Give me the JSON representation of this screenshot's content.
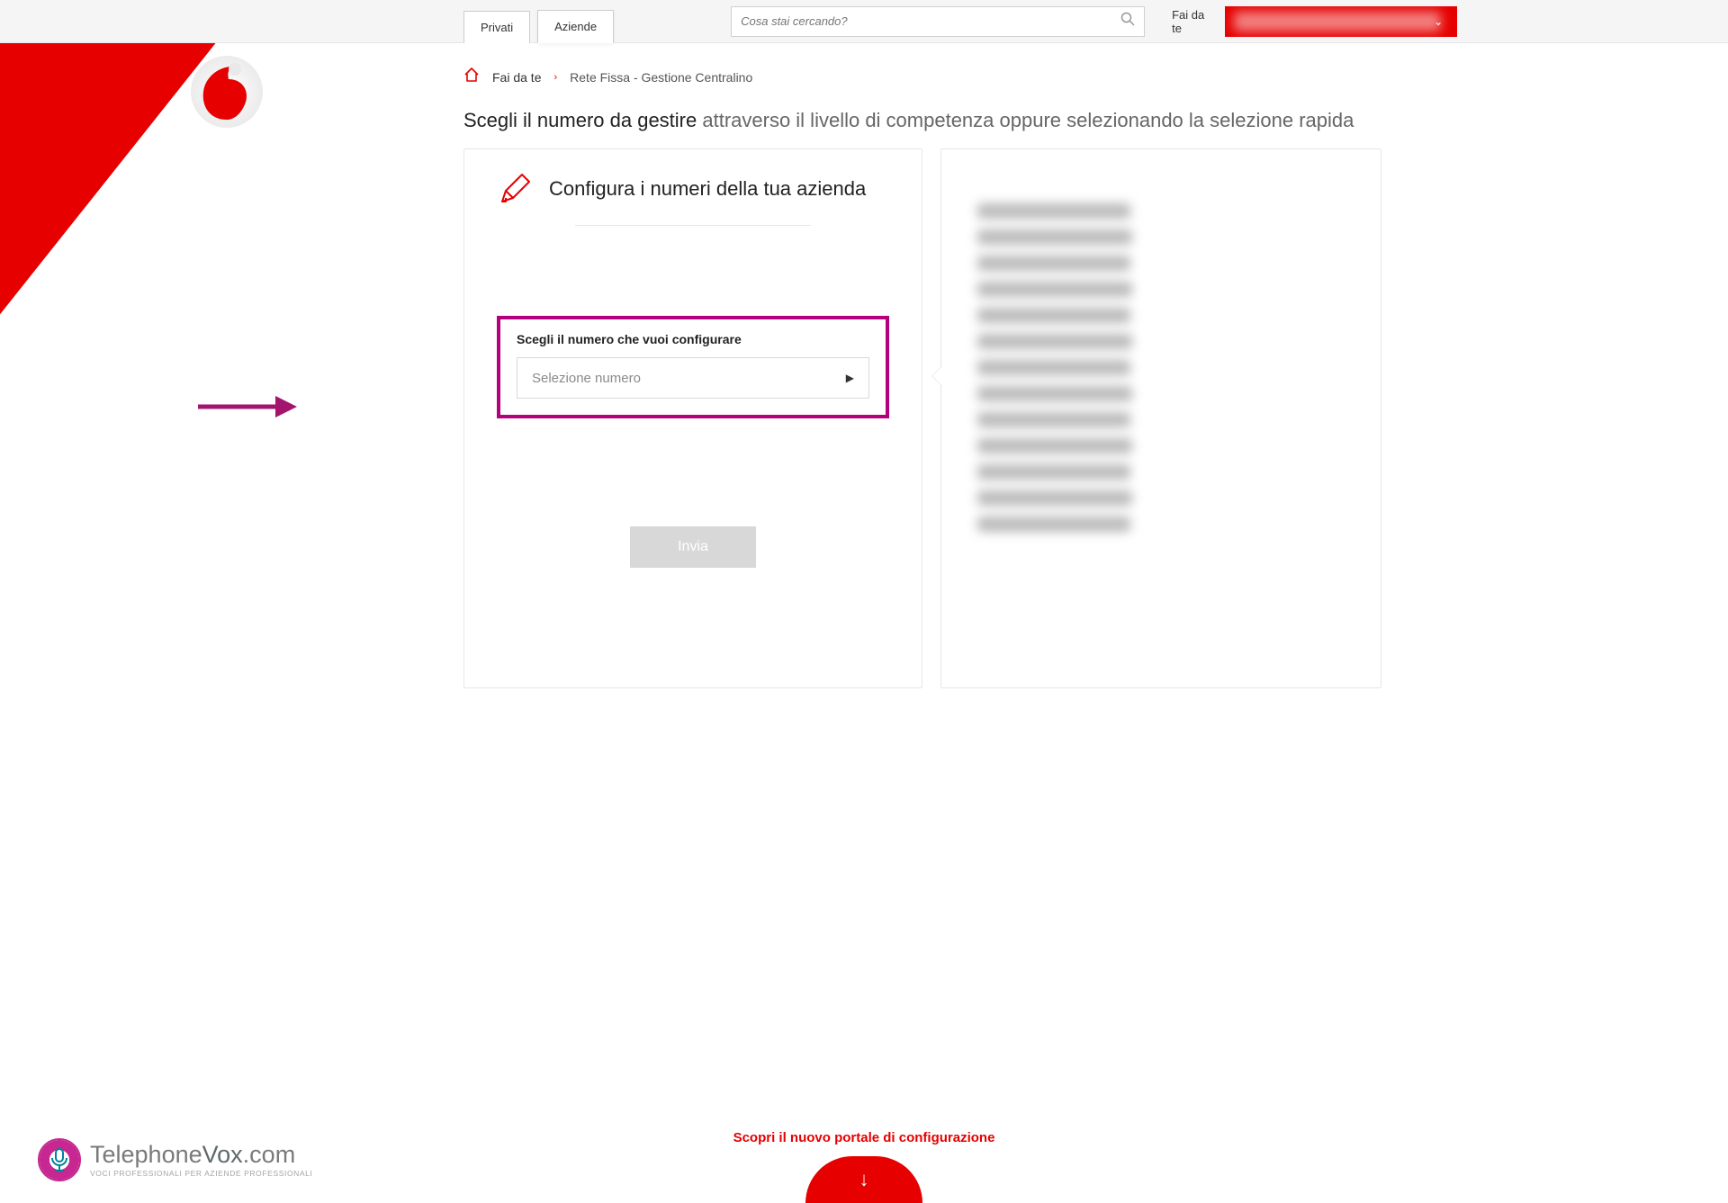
{
  "topbar": {
    "tab_privati": "Privati",
    "tab_aziende": "Aziende",
    "search_placeholder": "Cosa stai cercando?",
    "faidate_label": "Fai da te"
  },
  "breadcrumb": {
    "home": "Fai da te",
    "current": "Rete Fissa - Gestione Centralino"
  },
  "heading": {
    "bold": "Scegli il numero da gestire",
    "rest": " attraverso il livello di competenza oppure selezionando la selezione rapida"
  },
  "card_left": {
    "title": "Configura i numeri della tua azienda",
    "highlight_label": "Scegli il numero che vuoi configurare",
    "selector_placeholder": "Selezione numero",
    "submit": "Invia"
  },
  "footer": {
    "cta": "Scopri il nuovo portale di configurazione",
    "arrow": "↓"
  },
  "watermark": {
    "brand_a": "Telephone",
    "brand_b": "Vox",
    "brand_c": ".com",
    "tagline": "VOCI PROFESSIONALI PER AZIENDE PROFESSIONALI"
  }
}
